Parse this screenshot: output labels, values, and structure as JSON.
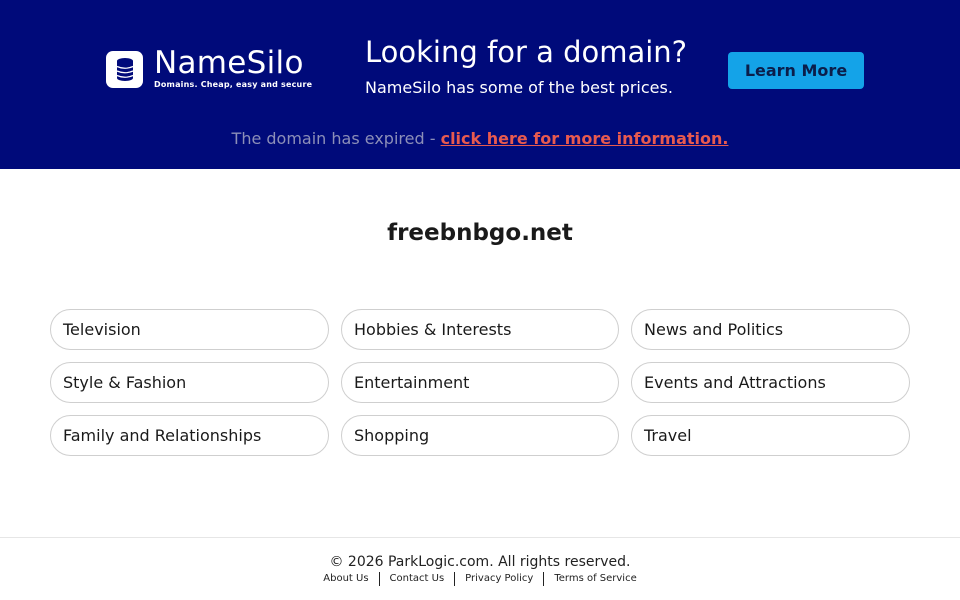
{
  "brand": {
    "name": "NameSilo",
    "tagline": "Domains. Cheap, easy and secure"
  },
  "promo": {
    "title": "Looking for a domain?",
    "subtitle": "NameSilo has some of the best prices.",
    "button_label": "Learn More"
  },
  "notice": {
    "text": "The domain has expired - ",
    "link_label": "click here for more information."
  },
  "domain": "freebnbgo.net",
  "categories": [
    "Television",
    "Hobbies & Interests",
    "News and Politics",
    "Style & Fashion",
    "Entertainment",
    "Events and Attractions",
    "Family and Relationships",
    "Shopping",
    "Travel"
  ],
  "footer": {
    "copyright": "© 2026 ParkLogic.com. All rights reserved.",
    "links": [
      "About Us",
      "Contact Us",
      "Privacy Policy",
      "Terms of Service"
    ]
  },
  "colors": {
    "banner_bg": "#000a7a",
    "button_bg": "#14a3e8",
    "link_red": "#e85a4f"
  },
  "icons": {
    "logo": "database-stack-icon"
  }
}
